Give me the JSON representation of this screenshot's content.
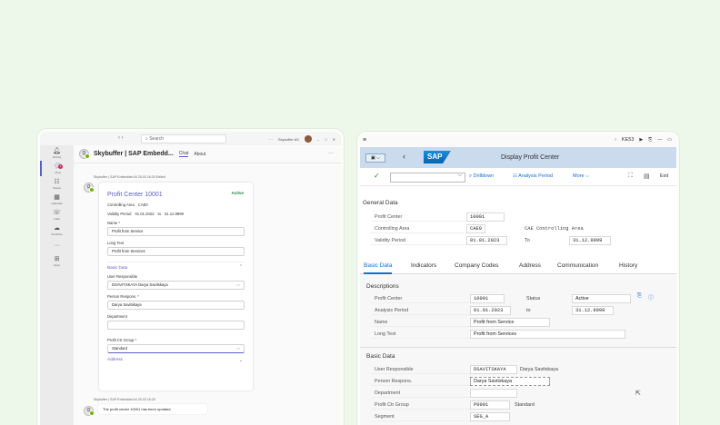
{
  "teams": {
    "search_placeholder": "Search",
    "user_name": "Skybuffer AS",
    "nav": "‹  ›",
    "rail": [
      {
        "label": "Activity",
        "icon": "bell-icon"
      },
      {
        "label": "Chat",
        "icon": "chat-icon",
        "badge": "1"
      },
      {
        "label": "Teams",
        "icon": "teams-icon"
      },
      {
        "label": "Calendar",
        "icon": "calendar-icon"
      },
      {
        "label": "Calls",
        "icon": "phone-icon"
      },
      {
        "label": "OneDrive",
        "icon": "cloud-icon"
      },
      {
        "label": "···",
        "icon": "more-icon"
      },
      {
        "label": "Apps",
        "icon": "apps-icon"
      }
    ],
    "chat_title": "Skybuffer | SAP Embedd...",
    "tabs": [
      "Chat",
      "About"
    ],
    "msg_meta": "Skybuffer | SAP Embedded AI   25.03 16:29   Edited",
    "card": {
      "title": "Profit Center 10001",
      "status": "Active",
      "controlling_area_label": "Controlling Area",
      "controlling_area": "CAE0",
      "validity_label": "Validity Period",
      "valid_from": "01.01.2023",
      "to_label": "to",
      "valid_to": "31.12.9999",
      "name_label": "Name *",
      "name": "Profit from Service",
      "long_text_label": "Long Text",
      "long_text": "Profit from Services",
      "basic_data_label": "Basic Data",
      "user_resp_label": "User Responsible",
      "user_resp": "DSAVITSKAYA Darya Savitskaya",
      "person_resp_label": "Person Respons. *",
      "person_resp": "Darya Savitskaya",
      "department_label": "Department",
      "department": "",
      "pctr_group_label": "Profit Ctr Group *",
      "pctr_group": "Standard",
      "address_label": "Address"
    },
    "reply_meta": "Skybuffer | SAP Embedded AI   25.03 16:29",
    "reply_text": "The profit center 10001 has been updated."
  },
  "sap": {
    "tcode": "KE53",
    "logo": "SAP",
    "title": "Display Profit Center",
    "toolbar": {
      "drilldown": "Drilldown",
      "analysis": "Analysis Period",
      "more": "More",
      "exit": "Exit"
    },
    "general": {
      "title": "General Data",
      "profit_center_label": "Profit Center",
      "profit_center": "10001",
      "controlling_area_label": "Controlling Area",
      "controlling_area": "CAE0",
      "controlling_area_text": "CAE Controlling Area",
      "validity_label": "Validity Period",
      "valid_from": "01.01.2023",
      "to_label": "To",
      "valid_to": "31.12.9999"
    },
    "tabs": [
      "Basic Data",
      "Indicators",
      "Company Codes",
      "Address",
      "Communication",
      "History"
    ],
    "descriptions": {
      "title": "Descriptions",
      "profit_center_label": "Profit Center",
      "profit_center": "10001",
      "status_label": "Status",
      "status": "Active",
      "analysis_label": "Analysis Period",
      "from": "01.01.2023",
      "to_label": "to",
      "to": "31.12.9999",
      "name_label": "Name",
      "name": "Profit from Service",
      "long_text_label": "Long Text",
      "long_text": "Profit from Services"
    },
    "basic": {
      "title": "Basic Data",
      "user_resp_label": "User Responsible",
      "user_resp": "DSAVITSKAYA",
      "user_resp_text": "Darya Savitskaya",
      "person_resp_label": "Person Respons.",
      "person_resp": "Darya Savitskaya",
      "department_label": "Department",
      "department": "",
      "pctr_group_label": "Profit Ctr Group",
      "pctr_group": "P0001",
      "pctr_group_text": "Standard",
      "segment_label": "Segment",
      "segment": "SEG_A"
    }
  }
}
